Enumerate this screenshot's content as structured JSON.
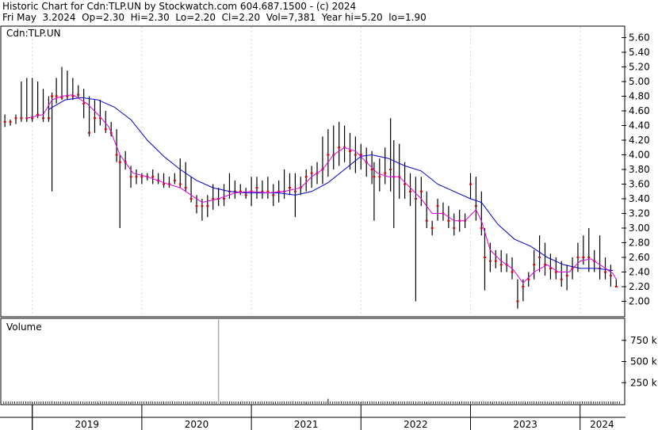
{
  "header": {
    "line1": "Historic Chart for Cdn:TLP.UN by Stockwatch.com 604.687.1500 - (c) 2024",
    "line2": "Fri May  3.2024  Op=2.30  Hi=2.30  Lo=2.20  Cl=2.20  Vol=7,381  Year hi=5.20  lo=1.90"
  },
  "chart_data": [
    {
      "type": "line",
      "panel": "price",
      "symbol_label": "Cdn:TLP.UN",
      "ylim": [
        1.9,
        5.7
      ],
      "y_ticks": [
        "5.60",
        "5.40",
        "5.20",
        "5.00",
        "4.80",
        "4.60",
        "4.40",
        "4.20",
        "4.00",
        "3.80",
        "3.60",
        "3.40",
        "3.20",
        "3.00",
        "2.80",
        "2.60",
        "2.40",
        "2.20",
        "2.00"
      ],
      "x_ticks": [
        "2019",
        "2020",
        "2021",
        "2022",
        "2023",
        "2024"
      ],
      "x_range": [
        2018.72,
        2024.4
      ],
      "colors": {
        "bar": "#000000",
        "close_dot": "#e00000",
        "ma_fast": "#dd00dd",
        "ma_slow": "#0000cc",
        "grid": "#000000"
      },
      "price_bars": [
        [
          2018.75,
          4.55,
          4.38,
          4.45
        ],
        [
          2018.8,
          4.48,
          4.4,
          4.45
        ],
        [
          2018.85,
          4.55,
          4.42,
          4.5
        ],
        [
          2018.9,
          5.0,
          4.45,
          4.5
        ],
        [
          2018.95,
          5.05,
          4.45,
          4.5
        ],
        [
          2019.0,
          5.05,
          4.45,
          4.5
        ],
        [
          2019.05,
          5.0,
          4.5,
          4.55
        ],
        [
          2019.1,
          4.9,
          4.45,
          4.5
        ],
        [
          2019.15,
          4.8,
          4.45,
          4.5
        ],
        [
          2019.18,
          4.85,
          3.5,
          4.8
        ],
        [
          2019.22,
          5.05,
          4.7,
          4.8
        ],
        [
          2019.27,
          5.2,
          4.75,
          4.78
        ],
        [
          2019.32,
          5.15,
          4.75,
          4.8
        ],
        [
          2019.37,
          5.05,
          4.75,
          4.8
        ],
        [
          2019.42,
          4.95,
          4.78,
          4.82
        ],
        [
          2019.47,
          4.9,
          4.5,
          4.7
        ],
        [
          2019.52,
          4.8,
          4.25,
          4.3
        ],
        [
          2019.57,
          4.75,
          4.3,
          4.5
        ],
        [
          2019.62,
          4.75,
          4.4,
          4.5
        ],
        [
          2019.67,
          4.6,
          4.3,
          4.35
        ],
        [
          2019.72,
          4.45,
          4.25,
          4.3
        ],
        [
          2019.77,
          4.35,
          3.9,
          4.0
        ],
        [
          2019.8,
          4.0,
          3.0,
          3.9
        ],
        [
          2019.85,
          4.05,
          3.8,
          3.9
        ],
        [
          2019.9,
          3.85,
          3.55,
          3.7
        ],
        [
          2019.95,
          3.8,
          3.6,
          3.7
        ],
        [
          2020.0,
          3.75,
          3.6,
          3.7
        ],
        [
          2020.05,
          3.75,
          3.65,
          3.7
        ],
        [
          2020.1,
          3.8,
          3.6,
          3.7
        ],
        [
          2020.15,
          3.75,
          3.6,
          3.65
        ],
        [
          2020.2,
          3.75,
          3.55,
          3.6
        ],
        [
          2020.25,
          3.7,
          3.55,
          3.6
        ],
        [
          2020.3,
          3.75,
          3.6,
          3.65
        ],
        [
          2020.35,
          3.95,
          3.55,
          3.6
        ],
        [
          2020.4,
          3.9,
          3.5,
          3.55
        ],
        [
          2020.45,
          3.7,
          3.35,
          3.4
        ],
        [
          2020.5,
          3.45,
          3.2,
          3.3
        ],
        [
          2020.55,
          3.4,
          3.1,
          3.3
        ],
        [
          2020.6,
          3.45,
          3.15,
          3.3
        ],
        [
          2020.65,
          3.6,
          3.25,
          3.4
        ],
        [
          2020.7,
          3.55,
          3.3,
          3.4
        ],
        [
          2020.75,
          3.6,
          3.3,
          3.4
        ],
        [
          2020.8,
          3.75,
          3.4,
          3.5
        ],
        [
          2020.85,
          3.65,
          3.4,
          3.5
        ],
        [
          2020.9,
          3.6,
          3.45,
          3.5
        ],
        [
          2020.95,
          3.55,
          3.4,
          3.45
        ],
        [
          2021.0,
          3.7,
          3.3,
          3.5
        ],
        [
          2021.05,
          3.7,
          3.4,
          3.55
        ],
        [
          2021.1,
          3.65,
          3.4,
          3.5
        ],
        [
          2021.15,
          3.7,
          3.4,
          3.5
        ],
        [
          2021.2,
          3.6,
          3.3,
          3.45
        ],
        [
          2021.25,
          3.65,
          3.35,
          3.5
        ],
        [
          2021.3,
          3.8,
          3.4,
          3.5
        ],
        [
          2021.35,
          3.75,
          3.45,
          3.55
        ],
        [
          2021.4,
          3.75,
          3.15,
          3.5
        ],
        [
          2021.45,
          3.7,
          3.45,
          3.55
        ],
        [
          2021.5,
          3.8,
          3.5,
          3.7
        ],
        [
          2021.55,
          3.85,
          3.55,
          3.75
        ],
        [
          2021.6,
          3.9,
          3.6,
          3.75
        ],
        [
          2021.65,
          4.25,
          3.6,
          3.8
        ],
        [
          2021.7,
          4.35,
          3.7,
          4.0
        ],
        [
          2021.75,
          4.4,
          3.8,
          4.0
        ],
        [
          2021.8,
          4.45,
          3.85,
          4.1
        ],
        [
          2021.85,
          4.4,
          3.9,
          4.1
        ],
        [
          2021.9,
          4.3,
          3.8,
          4.05
        ],
        [
          2021.95,
          4.25,
          3.75,
          4.0
        ],
        [
          2022.0,
          4.15,
          3.8,
          4.0
        ],
        [
          2022.05,
          4.1,
          3.7,
          3.9
        ],
        [
          2022.1,
          4.05,
          3.6,
          3.8
        ],
        [
          2022.12,
          3.9,
          3.1,
          3.7
        ],
        [
          2022.17,
          3.95,
          3.5,
          3.7
        ],
        [
          2022.22,
          4.1,
          3.6,
          3.75
        ],
        [
          2022.27,
          4.5,
          3.5,
          3.8
        ],
        [
          2022.3,
          4.2,
          3.0,
          3.7
        ],
        [
          2022.35,
          4.15,
          3.4,
          3.7
        ],
        [
          2022.4,
          3.9,
          3.4,
          3.6
        ],
        [
          2022.45,
          3.75,
          3.3,
          3.5
        ],
        [
          2022.5,
          3.7,
          2.0,
          3.4
        ],
        [
          2022.55,
          3.7,
          3.3,
          3.5
        ],
        [
          2022.6,
          3.5,
          3.0,
          3.1
        ],
        [
          2022.65,
          3.1,
          2.9,
          3.0
        ],
        [
          2022.7,
          3.4,
          3.1,
          3.3
        ],
        [
          2022.75,
          3.35,
          3.1,
          3.2
        ],
        [
          2022.8,
          3.3,
          3.0,
          3.1
        ],
        [
          2022.85,
          3.2,
          2.9,
          3.0
        ],
        [
          2022.9,
          3.25,
          2.95,
          3.1
        ],
        [
          2022.95,
          3.2,
          3.0,
          3.1
        ],
        [
          2023.0,
          3.75,
          3.4,
          3.6
        ],
        [
          2023.05,
          3.7,
          3.1,
          3.3
        ],
        [
          2023.1,
          3.5,
          2.9,
          3.0
        ],
        [
          2023.13,
          3.0,
          2.15,
          2.6
        ],
        [
          2023.18,
          2.8,
          2.4,
          2.55
        ],
        [
          2023.23,
          2.7,
          2.45,
          2.55
        ],
        [
          2023.28,
          2.7,
          2.4,
          2.5
        ],
        [
          2023.33,
          2.65,
          2.4,
          2.5
        ],
        [
          2023.38,
          2.6,
          2.3,
          2.4
        ],
        [
          2023.43,
          2.3,
          1.9,
          2.0
        ],
        [
          2023.48,
          2.3,
          2.0,
          2.2
        ],
        [
          2023.53,
          2.4,
          2.2,
          2.3
        ],
        [
          2023.58,
          2.7,
          2.3,
          2.5
        ],
        [
          2023.63,
          2.9,
          2.4,
          2.6
        ],
        [
          2023.68,
          2.8,
          2.35,
          2.5
        ],
        [
          2023.73,
          2.65,
          2.3,
          2.45
        ],
        [
          2023.78,
          2.6,
          2.3,
          2.4
        ],
        [
          2023.83,
          2.55,
          2.2,
          2.3
        ],
        [
          2023.88,
          2.5,
          2.15,
          2.35
        ],
        [
          2023.93,
          2.6,
          2.3,
          2.45
        ],
        [
          2023.98,
          2.8,
          2.4,
          2.6
        ],
        [
          2024.03,
          2.9,
          2.5,
          2.6
        ],
        [
          2024.08,
          3.0,
          2.4,
          2.6
        ],
        [
          2024.13,
          2.7,
          2.4,
          2.55
        ],
        [
          2024.18,
          2.9,
          2.3,
          2.45
        ],
        [
          2024.23,
          2.6,
          2.3,
          2.4
        ],
        [
          2024.28,
          2.5,
          2.2,
          2.35
        ],
        [
          2024.33,
          2.3,
          2.2,
          2.2
        ]
      ],
      "ma_fast": [
        [
          2018.95,
          4.5
        ],
        [
          2019.1,
          4.55
        ],
        [
          2019.18,
          4.75
        ],
        [
          2019.27,
          4.8
        ],
        [
          2019.37,
          4.82
        ],
        [
          2019.5,
          4.7
        ],
        [
          2019.6,
          4.55
        ],
        [
          2019.7,
          4.38
        ],
        [
          2019.8,
          4.0
        ],
        [
          2019.92,
          3.75
        ],
        [
          2020.05,
          3.7
        ],
        [
          2020.2,
          3.62
        ],
        [
          2020.35,
          3.55
        ],
        [
          2020.45,
          3.45
        ],
        [
          2020.55,
          3.35
        ],
        [
          2020.7,
          3.4
        ],
        [
          2020.85,
          3.48
        ],
        [
          2021.0,
          3.5
        ],
        [
          2021.15,
          3.48
        ],
        [
          2021.3,
          3.5
        ],
        [
          2021.45,
          3.55
        ],
        [
          2021.55,
          3.7
        ],
        [
          2021.65,
          3.8
        ],
        [
          2021.75,
          4.0
        ],
        [
          2021.85,
          4.1
        ],
        [
          2021.95,
          4.05
        ],
        [
          2022.05,
          3.9
        ],
        [
          2022.15,
          3.75
        ],
        [
          2022.25,
          3.7
        ],
        [
          2022.35,
          3.7
        ],
        [
          2022.45,
          3.55
        ],
        [
          2022.55,
          3.4
        ],
        [
          2022.65,
          3.2
        ],
        [
          2022.75,
          3.2
        ],
        [
          2022.85,
          3.1
        ],
        [
          2022.95,
          3.1
        ],
        [
          2023.05,
          3.25
        ],
        [
          2023.1,
          3.1
        ],
        [
          2023.18,
          2.7
        ],
        [
          2023.28,
          2.55
        ],
        [
          2023.38,
          2.45
        ],
        [
          2023.48,
          2.25
        ],
        [
          2023.58,
          2.4
        ],
        [
          2023.7,
          2.5
        ],
        [
          2023.8,
          2.4
        ],
        [
          2023.9,
          2.4
        ],
        [
          2024.0,
          2.55
        ],
        [
          2024.1,
          2.58
        ],
        [
          2024.2,
          2.48
        ],
        [
          2024.3,
          2.38
        ],
        [
          2024.33,
          2.3
        ]
      ],
      "ma_slow": [
        [
          2019.15,
          4.62
        ],
        [
          2019.3,
          4.75
        ],
        [
          2019.45,
          4.78
        ],
        [
          2019.6,
          4.75
        ],
        [
          2019.75,
          4.65
        ],
        [
          2019.9,
          4.48
        ],
        [
          2020.05,
          4.2
        ],
        [
          2020.2,
          3.98
        ],
        [
          2020.35,
          3.8
        ],
        [
          2020.5,
          3.65
        ],
        [
          2020.65,
          3.55
        ],
        [
          2020.8,
          3.5
        ],
        [
          2020.95,
          3.48
        ],
        [
          2021.1,
          3.48
        ],
        [
          2021.25,
          3.48
        ],
        [
          2021.4,
          3.45
        ],
        [
          2021.55,
          3.5
        ],
        [
          2021.7,
          3.62
        ],
        [
          2021.85,
          3.8
        ],
        [
          2022.0,
          3.98
        ],
        [
          2022.1,
          4.0
        ],
        [
          2022.25,
          3.95
        ],
        [
          2022.4,
          3.85
        ],
        [
          2022.55,
          3.78
        ],
        [
          2022.7,
          3.6
        ],
        [
          2022.85,
          3.5
        ],
        [
          2023.0,
          3.4
        ],
        [
          2023.1,
          3.35
        ],
        [
          2023.25,
          3.05
        ],
        [
          2023.4,
          2.85
        ],
        [
          2023.55,
          2.75
        ],
        [
          2023.7,
          2.6
        ],
        [
          2023.85,
          2.5
        ],
        [
          2024.0,
          2.45
        ],
        [
          2024.15,
          2.45
        ],
        [
          2024.3,
          2.42
        ]
      ]
    },
    {
      "type": "bar",
      "panel": "volume",
      "title": "Volume",
      "ylim": [
        0,
        1000000
      ],
      "y_ticks": [
        "750 k",
        "500 k",
        "250 k"
      ],
      "colors": {
        "bar": "#000000",
        "spike": "#aaaaaa"
      },
      "volume": [
        [
          2019.0,
          15000
        ],
        [
          2019.3,
          12000
        ],
        [
          2019.6,
          10000
        ],
        [
          2019.9,
          18000
        ],
        [
          2020.2,
          12000
        ],
        [
          2020.5,
          20000
        ],
        [
          2020.7,
          995000
        ],
        [
          2020.9,
          14000
        ],
        [
          2021.2,
          11000
        ],
        [
          2021.5,
          16000
        ],
        [
          2021.7,
          60000
        ],
        [
          2022.0,
          20000
        ],
        [
          2022.3,
          22000
        ],
        [
          2022.6,
          18000
        ],
        [
          2022.9,
          14000
        ],
        [
          2023.2,
          15000
        ],
        [
          2023.5,
          12000
        ],
        [
          2023.8,
          14000
        ],
        [
          2024.1,
          12000
        ],
        [
          2024.3,
          20000
        ]
      ]
    }
  ]
}
